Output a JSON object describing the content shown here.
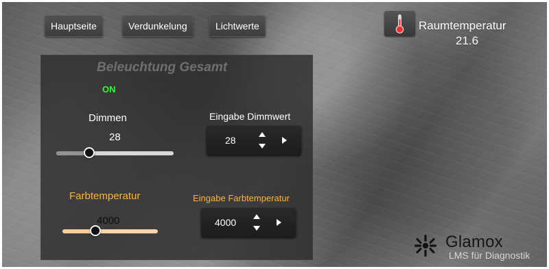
{
  "navigation": {
    "buttons": [
      {
        "label": "Hauptseite"
      },
      {
        "label": "Verdunkelung"
      },
      {
        "label": "Lichtwerte"
      }
    ]
  },
  "room_temperature": {
    "icon": "thermometer-icon",
    "label": "Raumtemperatur",
    "value": "21.6"
  },
  "lighting": {
    "title": "Beleuchtung Gesamt",
    "status": "ON",
    "dimming": {
      "label": "Dimmen",
      "value": "28",
      "level_percent": 28,
      "input_label": "Eingabe Dimmwert",
      "input_value": "28",
      "controls": {
        "up_icon": "triangle-up-icon",
        "down_icon": "triangle-down-icon",
        "go_icon": "triangle-right-icon"
      }
    },
    "color_temperature": {
      "label": "Farbtemperatur",
      "value": "4000",
      "range": [
        2700,
        6500
      ],
      "input_label": "Eingabe Farbtemperatur",
      "input_value": "4000",
      "controls": {
        "up_icon": "triangle-up-icon",
        "down_icon": "triangle-down-icon",
        "go_icon": "triangle-right-icon"
      }
    }
  },
  "branding": {
    "name": "Glamox",
    "subtitle": "LMS für Diagnostik",
    "icon": "glamox-logo-icon"
  },
  "colors": {
    "active": "#2fff2f",
    "warm_label": "#ffb13a",
    "panel": "#2b2b2b"
  }
}
